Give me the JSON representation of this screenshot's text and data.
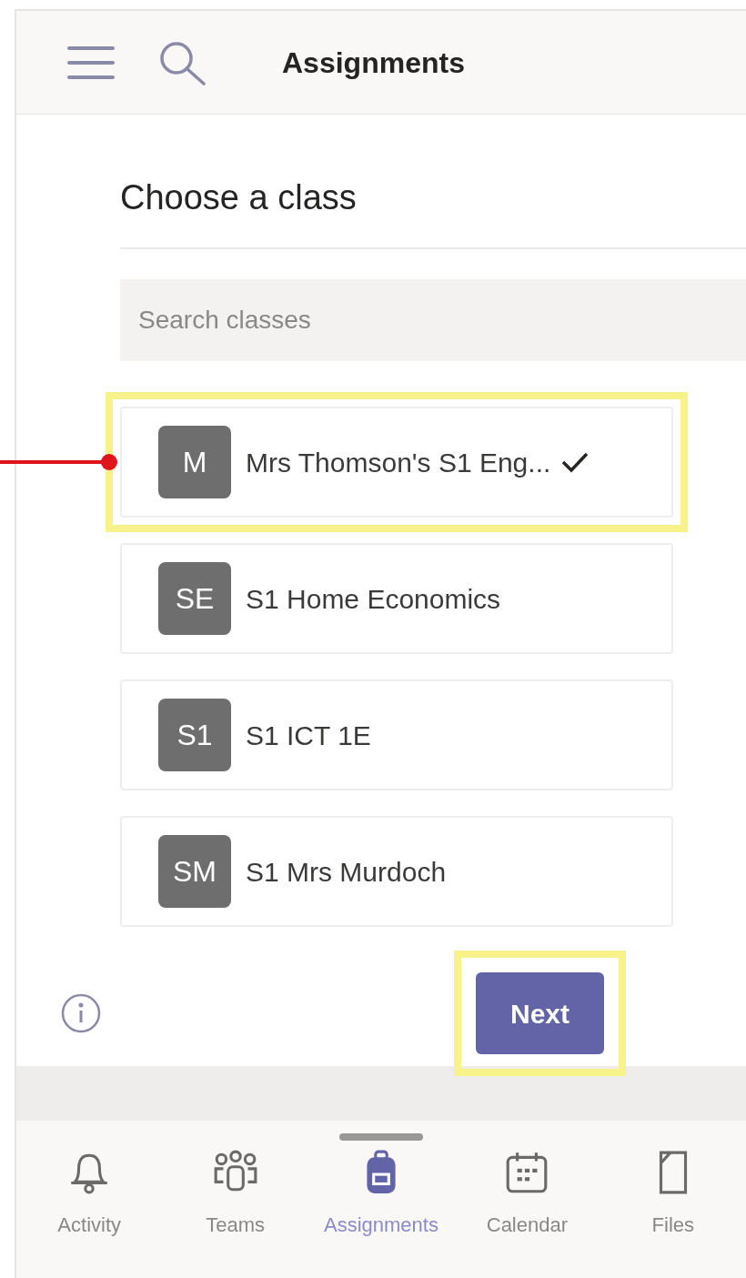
{
  "header": {
    "title": "Assignments"
  },
  "heading": "Choose a class",
  "search": {
    "placeholder": "Search classes"
  },
  "classes": [
    {
      "initials": "M",
      "name": "Mrs Thomson's S1 Eng...",
      "selected": true,
      "highlighted": true,
      "pointer": true
    },
    {
      "initials": "SE",
      "name": "S1 Home Economics",
      "selected": false,
      "highlighted": false,
      "pointer": false
    },
    {
      "initials": "S1",
      "name": "S1 ICT 1E",
      "selected": false,
      "highlighted": false,
      "pointer": false
    },
    {
      "initials": "SM",
      "name": "S1 Mrs Murdoch",
      "selected": false,
      "highlighted": false,
      "pointer": false
    }
  ],
  "next_button": {
    "label": "Next",
    "highlighted": true
  },
  "nav": [
    {
      "kind": "bell",
      "label": "Activity",
      "selected": false
    },
    {
      "kind": "people",
      "label": "Teams",
      "selected": false
    },
    {
      "kind": "backpack",
      "label": "Assignments",
      "selected": true
    },
    {
      "kind": "calendar",
      "label": "Calendar",
      "selected": false
    },
    {
      "kind": "file",
      "label": "Files",
      "selected": false
    }
  ]
}
